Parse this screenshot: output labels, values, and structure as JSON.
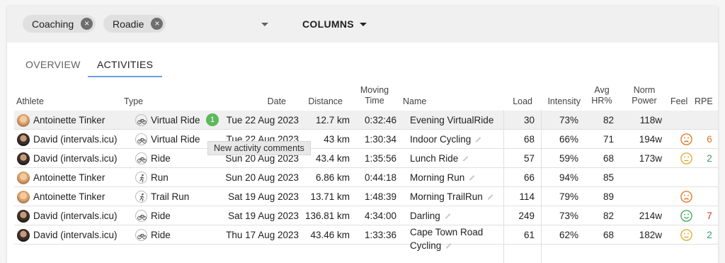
{
  "filters": {
    "chips": [
      {
        "label": "Coaching"
      },
      {
        "label": "Roadie"
      }
    ],
    "remove_icon": "×",
    "columns_label": "COLUMNS"
  },
  "tabs": [
    {
      "label": "OVERVIEW",
      "active": false
    },
    {
      "label": "ACTIVITIES",
      "active": true
    }
  ],
  "table": {
    "headers": {
      "athlete": "Athlete",
      "type": "Type",
      "date": "Date",
      "distance": "Distance",
      "moving_time_1": "Moving",
      "moving_time_2": "Time",
      "name": "Name",
      "load": "Load",
      "intensity": "Intensity",
      "avg_hr_1": "Avg",
      "avg_hr_2": "HR%",
      "norm_power_1": "Norm",
      "norm_power_2": "Power",
      "feel": "Feel",
      "rpe": "RPE"
    },
    "rows": [
      {
        "athlete": "Antoinette Tinker",
        "avatar": "antoinette",
        "type_icon": "bike-icon",
        "type": "Virtual Ride",
        "comments": "1",
        "date": "Tue 22 Aug 2023",
        "distance": "12.7 km",
        "time": "0:32:46",
        "name": "Evening VirtualRide",
        "name2": "",
        "load": "30",
        "intensity": "73%",
        "hr": "82",
        "power": "118w",
        "feel": "",
        "rpe": ""
      },
      {
        "athlete": "David (intervals.icu)",
        "avatar": "david",
        "type_icon": "bike-icon",
        "type": "Virtual Ride",
        "comments": "",
        "date": "Tue 22 Aug 2023",
        "distance": "43 km",
        "time": "1:30:34",
        "name": "Indoor Cycling",
        "name2": "",
        "load": "68",
        "intensity": "66%",
        "hr": "71",
        "power": "194w",
        "feel": "sad",
        "rpe": "6"
      },
      {
        "athlete": "David (intervals.icu)",
        "avatar": "david",
        "type_icon": "bike-icon",
        "type": "Ride",
        "comments": "",
        "date": "Sun 20 Aug 2023",
        "distance": "43.4 km",
        "time": "1:35:56",
        "name": "Lunch Ride",
        "name2": "",
        "load": "57",
        "intensity": "59%",
        "hr": "68",
        "power": "173w",
        "feel": "neutral",
        "rpe": "2"
      },
      {
        "athlete": "Antoinette Tinker",
        "avatar": "antoinette",
        "type_icon": "run-icon",
        "type": "Run",
        "comments": "",
        "date": "Sun 20 Aug 2023",
        "distance": "6.86 km",
        "time": "0:44:18",
        "name": "Morning Run",
        "name2": "",
        "load": "66",
        "intensity": "94%",
        "hr": "85",
        "power": "",
        "feel": "",
        "rpe": ""
      },
      {
        "athlete": "Antoinette Tinker",
        "avatar": "antoinette",
        "type_icon": "run-icon",
        "type": "Trail Run",
        "comments": "",
        "date": "Sat 19 Aug 2023",
        "distance": "13.71 km",
        "time": "1:48:39",
        "name": "Morning TrailRun",
        "name2": "",
        "load": "114",
        "intensity": "79%",
        "hr": "89",
        "power": "",
        "feel": "sad",
        "rpe": ""
      },
      {
        "athlete": "David (intervals.icu)",
        "avatar": "david",
        "type_icon": "bike-icon",
        "type": "Ride",
        "comments": "",
        "date": "Sat 19 Aug 2023",
        "distance": "136.81 km",
        "time": "4:34:00",
        "name": "Darling",
        "name2": "",
        "load": "249",
        "intensity": "73%",
        "hr": "82",
        "power": "214w",
        "feel": "happy",
        "rpe": "7"
      },
      {
        "athlete": "David (intervals.icu)",
        "avatar": "david",
        "type_icon": "bike-icon",
        "type": "Ride",
        "comments": "",
        "date": "Thu 17 Aug 2023",
        "distance": "43.46 km",
        "time": "1:33:36",
        "name": "Cape Town Road",
        "name2": "Cycling",
        "load": "61",
        "intensity": "62%",
        "hr": "68",
        "power": "182w",
        "feel": "neutral",
        "rpe": "2"
      }
    ]
  },
  "tooltip": "New activity comments",
  "colors": {
    "tab_indicator": "#6a9ee8",
    "badge": "#5cb85c",
    "feel_sad": "#e8711a",
    "feel_neutral": "#e0a82e",
    "feel_happy": "#3aa655",
    "rpe_6": "#e8711a",
    "rpe_2": "#3a9a66",
    "rpe_7": "#d0312d"
  }
}
